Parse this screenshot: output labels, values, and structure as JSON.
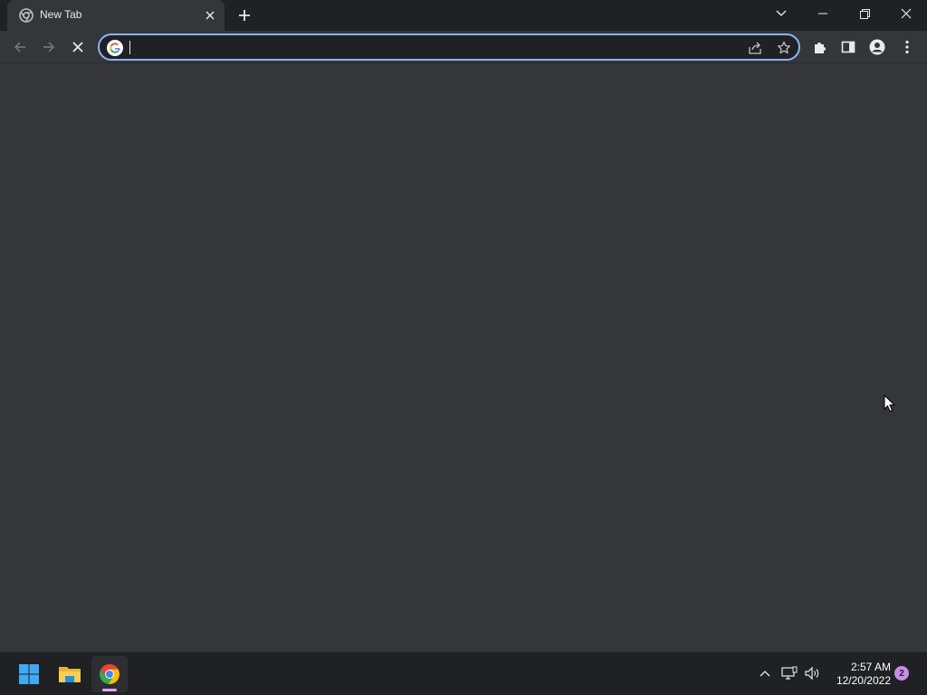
{
  "browser": {
    "tab": {
      "title": "New Tab",
      "favicon": "chrome-tab-icon"
    },
    "omnibox": {
      "value": "",
      "placeholder": ""
    },
    "icons": {
      "back": "arrow-left-icon",
      "forward": "arrow-right-icon",
      "stop": "stop-loading-icon",
      "share": "share-icon",
      "bookmark": "star-icon",
      "extensions": "puzzle-icon",
      "side_panel": "side-panel-icon",
      "profile": "profile-icon",
      "menu": "kebab-menu-icon"
    }
  },
  "taskbar": {
    "clock_time": "2:57 AM",
    "clock_date": "12/20/2022",
    "notification_count": "2",
    "apps": [
      "start-icon",
      "file-explorer-icon",
      "chrome-icon"
    ]
  },
  "colors": {
    "accent": "#8ab4f8",
    "frame": "#202124",
    "toolbar": "#35363a",
    "notification": "#c68ee6"
  }
}
